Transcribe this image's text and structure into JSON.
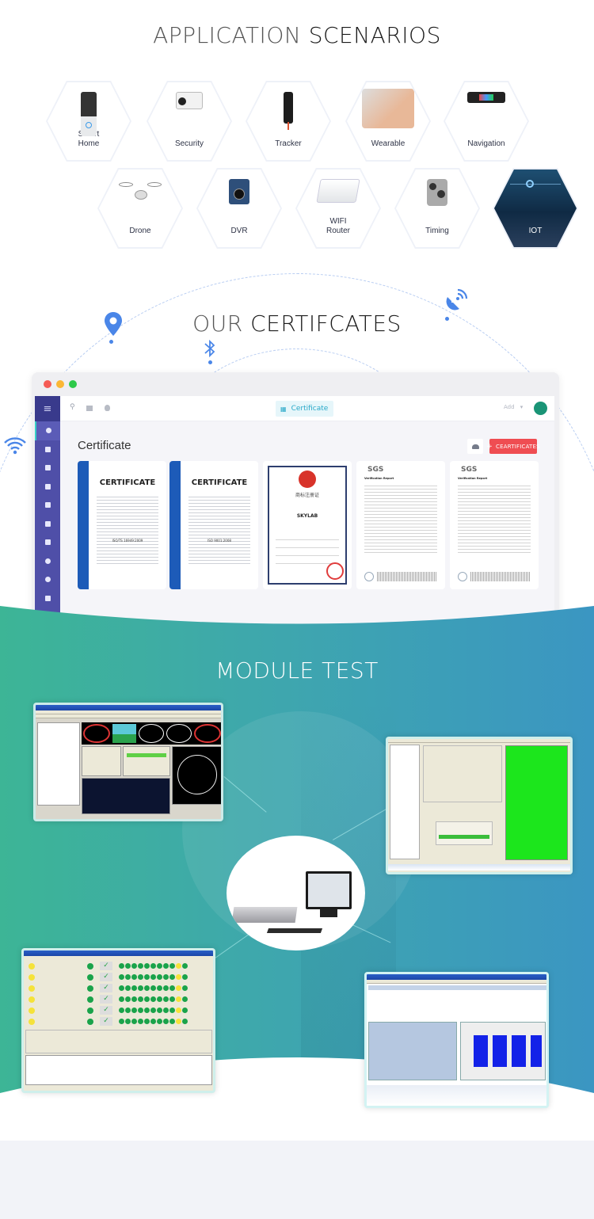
{
  "sections": {
    "applications": {
      "title_part1": "APPLICATION",
      "title_part2": "SCENARIOS",
      "items": [
        {
          "label": "Smart\nHome",
          "icon": "doorbell-icon"
        },
        {
          "label": "Security",
          "icon": "security-camera-icon"
        },
        {
          "label": "Tracker",
          "icon": "gps-tracker-icon"
        },
        {
          "label": "Wearable",
          "icon": "wearable-watch-icon"
        },
        {
          "label": "Navigation",
          "icon": "navigation-device-icon"
        },
        {
          "label": "Drone",
          "icon": "drone-icon"
        },
        {
          "label": "DVR",
          "icon": "dashcam-icon"
        },
        {
          "label": "WIFI\nRouter",
          "icon": "router-icon"
        },
        {
          "label": "Timing",
          "icon": "timing-watch-icon"
        },
        {
          "label": "IOT",
          "icon": "iot-city-icon"
        }
      ]
    },
    "certificates": {
      "title_part1": "OUR",
      "title_part2": "CERTIFCATES",
      "decor_icons": [
        "location-pin-icon",
        "bluetooth-icon",
        "satellite-dish-icon",
        "wifi-icon"
      ],
      "window": {
        "topbar_tab_label": "Certificate",
        "add_label": "Add",
        "page_heading": "Certificate",
        "add_button_label": "CEARTIFICATES",
        "sidebar_icons": [
          "menu-icon",
          "dashboard-icon",
          "contact-icon",
          "building-icon",
          "briefcase-icon",
          "document-icon",
          "mail-icon",
          "calendar-icon",
          "settings-icon",
          "user-icon",
          "trash-icon"
        ],
        "cards": [
          {
            "type": "iso-cert",
            "heading": "CERTIFICATE",
            "standard": "ISO/TS 16949:2009"
          },
          {
            "type": "iso-cert",
            "heading": "CERTIFICATE",
            "standard": "ISO 9001:2008"
          },
          {
            "type": "trademark",
            "heading": "商标注册证",
            "brand": "SKYLAB"
          },
          {
            "type": "sgs-report",
            "heading": "SGS",
            "subtitle": "Verification Report"
          },
          {
            "type": "sgs-report",
            "heading": "SGS",
            "subtitle": "Verification Report"
          }
        ]
      }
    },
    "module_test": {
      "title": "MODULE TEST",
      "screenshots": [
        "gnss-monitor-software",
        "rf-test-parameter-tool",
        "multi-channel-test-panel",
        "signal-analysis-software"
      ],
      "center_image": "test-equipment-workstation"
    }
  },
  "colors": {
    "accent_blue": "#4a86e8",
    "sidebar": "#4f4fa8",
    "red_button": "#ef4d52",
    "avatar": "#1a9476",
    "teal_start": "#3db596",
    "teal_end": "#3b96c2"
  }
}
